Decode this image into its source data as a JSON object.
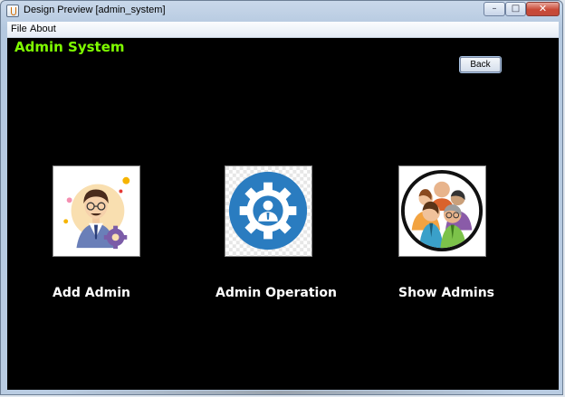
{
  "window": {
    "title": "Design Preview [admin_system]",
    "controls": {
      "minimize": "–",
      "maximize": "□",
      "close": "✕"
    }
  },
  "menu": {
    "items": [
      "File",
      "About"
    ]
  },
  "app": {
    "title": "Admin System",
    "title_color": "#7fff00",
    "back_label": "Back",
    "options": [
      {
        "label": "Add Admin",
        "icon": "admin-avatar-gear-icon"
      },
      {
        "label": "Admin Operation",
        "icon": "admin-operation-gear-icon"
      },
      {
        "label": "Show Admins",
        "icon": "admins-group-icon"
      }
    ]
  }
}
